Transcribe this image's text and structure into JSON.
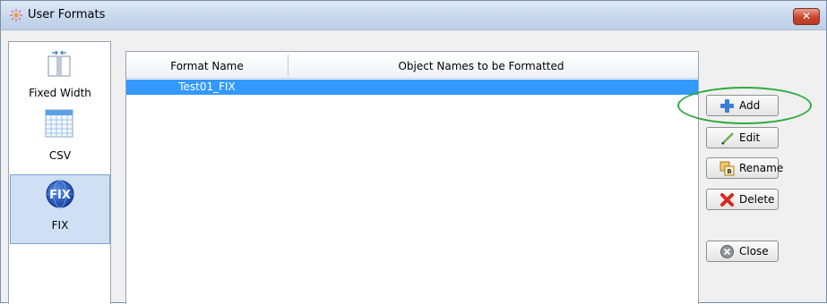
{
  "window": {
    "title": "User Formats",
    "close_symbol": "✕"
  },
  "sidebar": {
    "items": [
      {
        "label": "Fixed Width",
        "icon": "fixed-width-icon",
        "selected": false
      },
      {
        "label": "CSV",
        "icon": "csv-grid-icon",
        "selected": false
      },
      {
        "label": "FIX",
        "icon": "fix-globe-icon",
        "selected": true
      }
    ]
  },
  "table": {
    "columns": [
      "Format Name",
      "Object Names to be Formatted"
    ],
    "rows": [
      {
        "format_name": "Test01_FIX",
        "object_names": "",
        "selected": true
      }
    ]
  },
  "buttons": {
    "add": "Add",
    "edit": "Edit",
    "rename": "Rename",
    "delete": "Delete",
    "close": "Close"
  },
  "colors": {
    "selection": "#3399ff",
    "annotation": "#2eaa3c"
  }
}
